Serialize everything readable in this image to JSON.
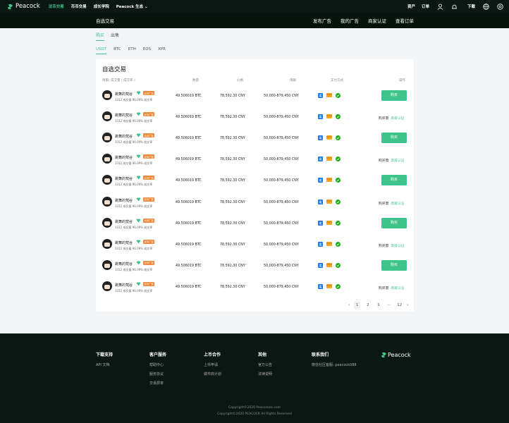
{
  "topnav": {
    "logo": "Peacock",
    "links": [
      "法币交易",
      "币币交易",
      "成长学院",
      "Peacock 生态 ⌄"
    ],
    "right": [
      "资产",
      "订单",
      "下载"
    ]
  },
  "subhead": {
    "title": "自选交易",
    "links": [
      "发布广告",
      "我的广告",
      "商家认证",
      "查看订单"
    ]
  },
  "tabs": {
    "side": [
      "购买",
      "出售"
    ],
    "coins": [
      "USDT",
      "BTC",
      "ETH",
      "EOS",
      "XPR"
    ]
  },
  "card": {
    "title": "自选交易",
    "headers": [
      "商家( 成交量 | 成交率 )",
      "数量",
      "价格",
      "限额",
      "支付方式",
      "操作"
    ]
  },
  "rows": [
    {
      "name": "跳舞的梵谷",
      "tag": "大众广告",
      "stats": "3312 成交量  96.09% 成交率",
      "qty": "49.506019 BTC",
      "price": "78,592.30 CNY",
      "limit": "50,000-879,450 CNY",
      "action": "buy",
      "btn": "购买"
    },
    {
      "name": "跳舞的梵谷",
      "tag": "大众广告",
      "stats": "3312 成交量  96.09% 成交率",
      "qty": "49.506019 BTC",
      "price": "78,592.30 CNY",
      "limit": "50,000-879,450 CNY",
      "action": "cert",
      "text": "购买需",
      "link": "高级认证"
    },
    {
      "name": "跳舞的梵谷",
      "tag": "大众广告",
      "stats": "3312 成交量  96.09% 成交率",
      "qty": "49.506019 BTC",
      "price": "78,592.30 CNY",
      "limit": "50,000-879,450 CNY",
      "action": "buy",
      "btn": "购买"
    },
    {
      "name": "跳舞的梵谷",
      "tag": "大众广告",
      "stats": "3312 成交量  96.09% 成交率",
      "qty": "49.506019 BTC",
      "price": "78,592.30 CNY",
      "limit": "50,000-879,450 CNY",
      "action": "cert",
      "text": "购买需",
      "link": "高级认证"
    },
    {
      "name": "跳舞的梵谷",
      "tag": "大众广告",
      "stats": "3312 成交量  96.09% 成交率",
      "qty": "49.506019 BTC",
      "price": "78,592.30 CNY",
      "limit": "50,000-879,450 CNY",
      "action": "buy",
      "btn": "购买"
    },
    {
      "name": "跳舞的梵谷",
      "tag": "大众广告",
      "stats": "3312 成交量  96.09% 成交率",
      "qty": "49.506019 BTC",
      "price": "78,592.30 CNY",
      "limit": "50,000-879,450 CNY",
      "action": "cert",
      "text": "购买需",
      "link": "高级认证"
    },
    {
      "name": "跳舞的梵谷",
      "tag": "大众广告",
      "stats": "3312 成交量  96.09% 成交率",
      "qty": "49.506019 BTC",
      "price": "78,592.30 CNY",
      "limit": "50,000-879,450 CNY",
      "action": "buy",
      "btn": "购买"
    },
    {
      "name": "跳舞的梵谷",
      "tag": "大众广告",
      "stats": "3312 成交量  96.09% 成交率",
      "qty": "49.506019 BTC",
      "price": "78,592.30 CNY",
      "limit": "50,000-879,450 CNY",
      "action": "cert",
      "text": "购买需",
      "link": "高级认证"
    },
    {
      "name": "跳舞的梵谷",
      "tag": "大众广告",
      "stats": "3312 成交量  96.09% 成交率",
      "qty": "49.506019 BTC",
      "price": "78,592.30 CNY",
      "limit": "50,000-879,450 CNY",
      "action": "buy",
      "btn": "购买"
    },
    {
      "name": "跳舞的梵谷",
      "tag": "大众广告",
      "stats": "3312 成交量  96.09% 成交率",
      "qty": "49.506019 BTC",
      "price": "78,592.30 CNY",
      "limit": "50,000-879,450 CNY",
      "action": "cert",
      "text": "购买需",
      "link": "高级认证"
    }
  ],
  "pager": {
    "prev": "‹",
    "pages": [
      "1",
      "2",
      "3",
      "···",
      "12"
    ],
    "next": "›"
  },
  "footer": {
    "cols": [
      {
        "title": "下载支持",
        "items": [
          "API 文档"
        ]
      },
      {
        "title": "客户服务",
        "items": [
          "帮助中心",
          "服务协议",
          "交易费率"
        ]
      },
      {
        "title": "上币合作",
        "items": [
          "上币申请",
          "做市商计划"
        ]
      },
      {
        "title": "其他",
        "items": [
          "官方公告",
          "法律说明"
        ]
      },
      {
        "title": "联系我们",
        "items": [
          "微信社区客服: peacock088"
        ]
      }
    ],
    "logo": "Peacock",
    "copy1": "Copyright©2020 Peacockex.com",
    "copy2": "Copyright©2020 PEACOCK All Rights Reserved"
  },
  "colors": {
    "accent": "#3ec48b",
    "nav_bg": "#0b1712",
    "tag": "#f08a3a"
  }
}
